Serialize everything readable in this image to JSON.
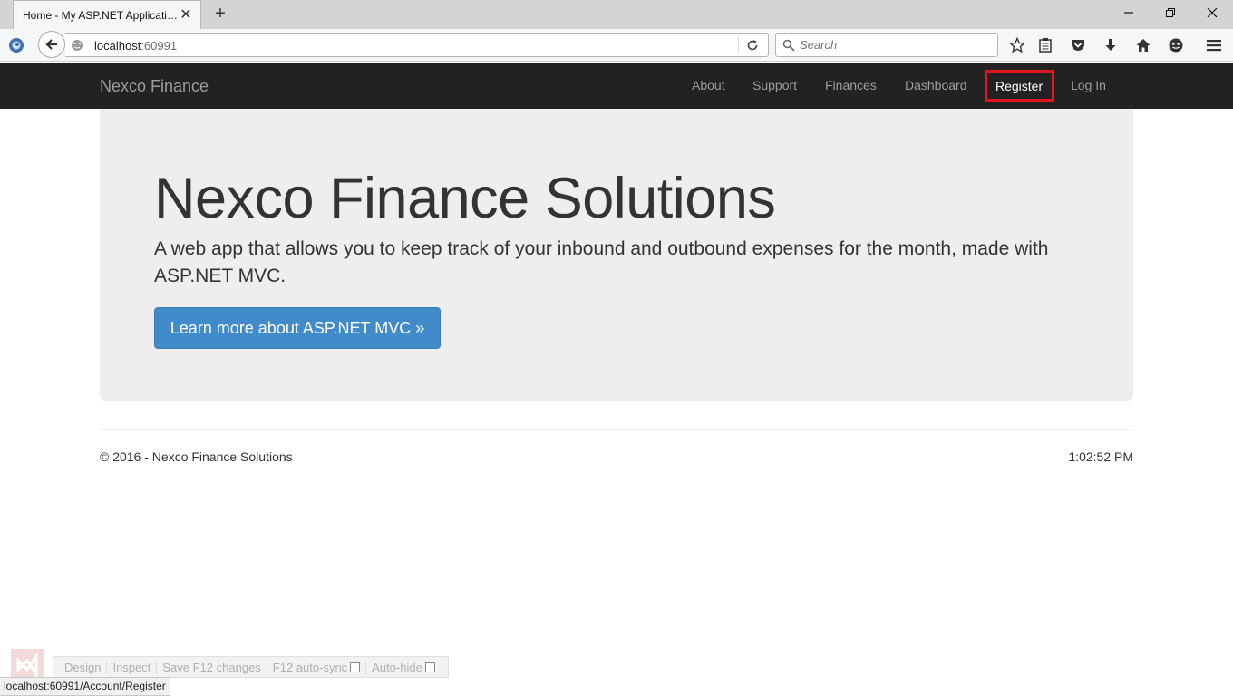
{
  "browser": {
    "tab_title": "Home - My ASP.NET Applicati…",
    "url_host": "localhost",
    "url_port": ":60991",
    "search_placeholder": "Search",
    "status_url": "localhost:60991/Account/Register"
  },
  "site": {
    "brand": "Nexco Finance",
    "nav": {
      "about": "About",
      "support": "Support",
      "finances": "Finances",
      "dashboard": "Dashboard",
      "register": "Register",
      "login": "Log In"
    },
    "jumbotron": {
      "title": "Nexco Finance Solutions",
      "lead": "A web app that allows you to keep track of your inbound and outbound expenses for the month, made with ASP.NET MVC.",
      "button": "Learn more about ASP.NET MVC »"
    },
    "footer": {
      "copyright": "© 2016 - Nexco Finance Solutions",
      "time": "1:02:52 PM"
    }
  },
  "browser_link": {
    "design": "Design",
    "inspect": "Inspect",
    "save": "Save F12 changes",
    "autosync": "F12 auto-sync",
    "autohide": "Auto-hide"
  },
  "colors": {
    "navbar_bg": "#222222",
    "highlight": "#e0151e",
    "primary_button": "#428bca",
    "jumbotron_bg": "#eeeeee"
  }
}
